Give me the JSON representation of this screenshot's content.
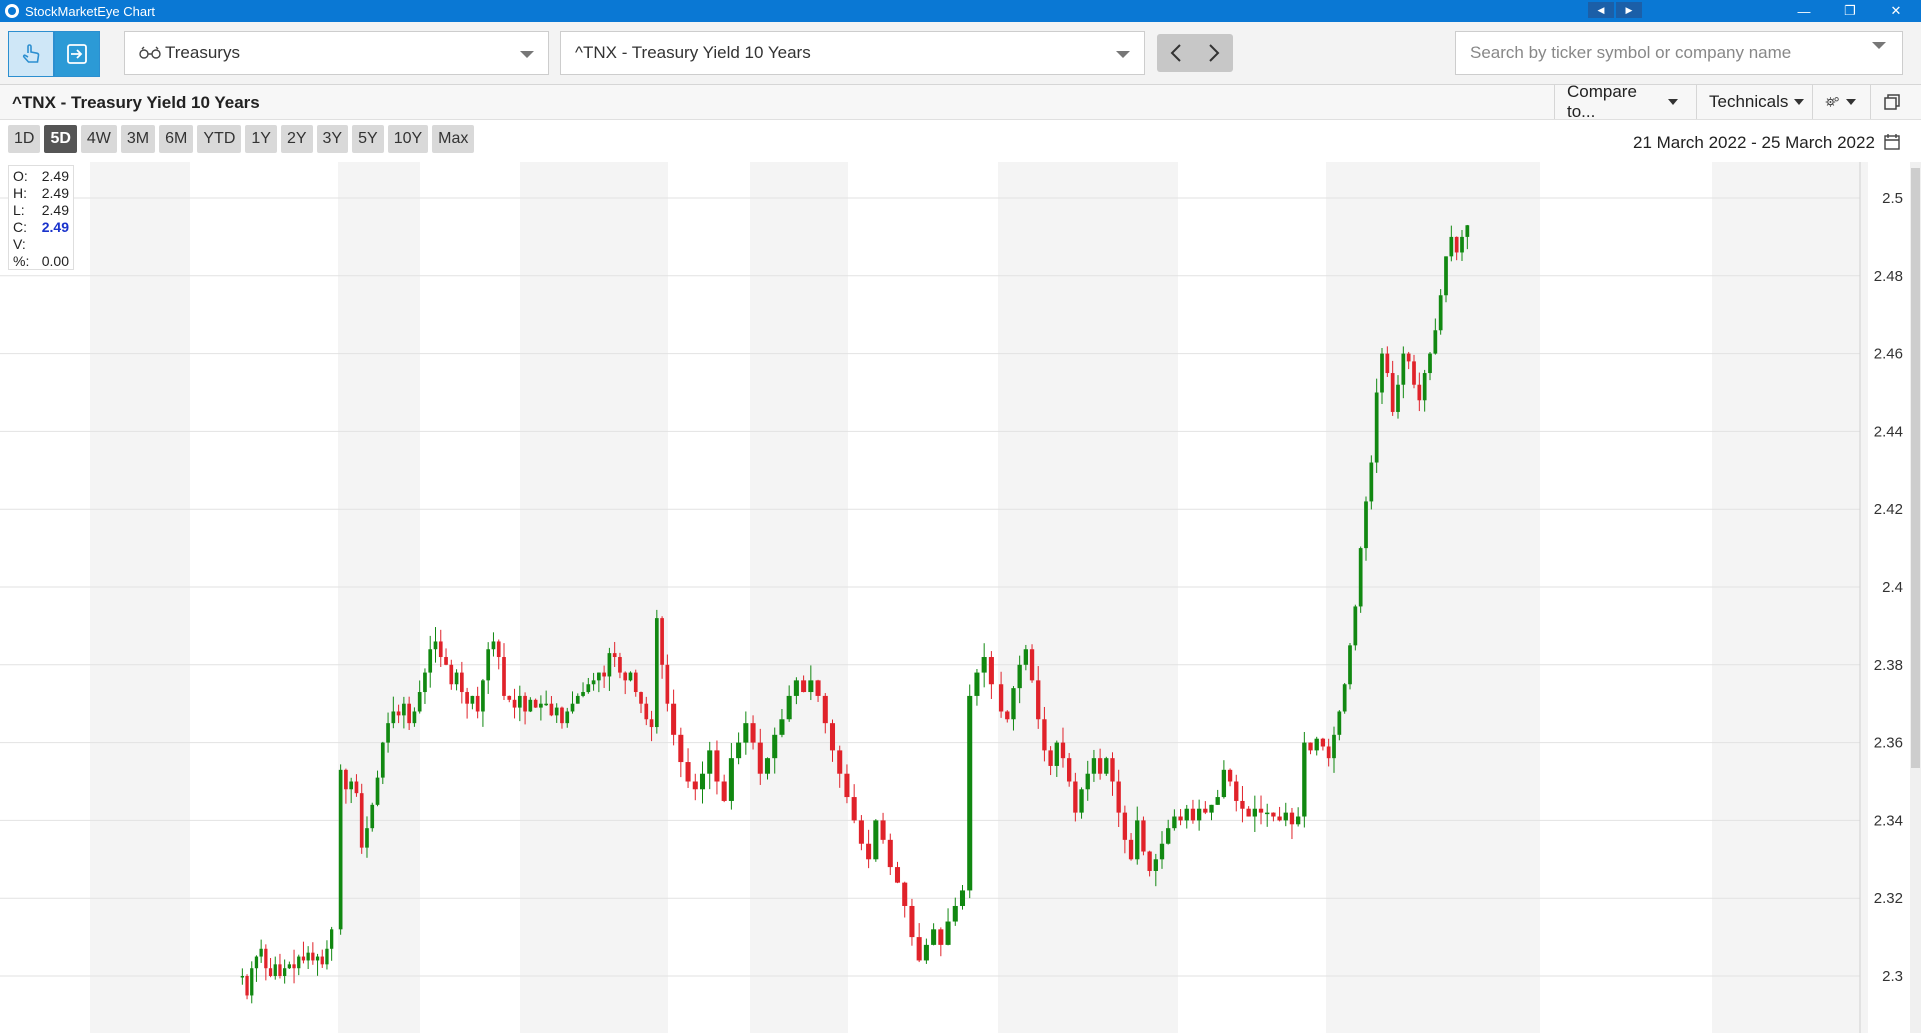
{
  "window": {
    "title": "StockMarketEye Chart"
  },
  "toolbar": {
    "list_dropdown": "Treasurys",
    "symbol_dropdown": "^TNX - Treasury Yield 10 Years",
    "search_placeholder": "Search by ticker symbol or company name"
  },
  "header": {
    "symbol_title": "^TNX - Treasury Yield 10 Years",
    "compare_label": "Compare to...",
    "technicals_label": "Technicals"
  },
  "ranges": [
    "1D",
    "5D",
    "4W",
    "3M",
    "6M",
    "YTD",
    "1Y",
    "2Y",
    "3Y",
    "5Y",
    "10Y",
    "Max"
  ],
  "active_range": "5D",
  "date_range": "21 March 2022 - 25 March 2022",
  "ohlc": {
    "o_label": "O:",
    "o": "2.49",
    "h_label": "H:",
    "h": "2.49",
    "l_label": "L:",
    "l": "2.49",
    "c_label": "C:",
    "c": "2.49",
    "v_label": "V:",
    "v": "",
    "p_label": "%:",
    "p": "0.00"
  },
  "colors": {
    "up": "#118811",
    "down": "#e0222a",
    "accent": "#0a78d4",
    "band": "#f4f4f4"
  },
  "chart_data": {
    "type": "candlestick",
    "ylim": [
      2.296,
      2.514
    ],
    "y_ticks": [
      2.3,
      2.32,
      2.34,
      2.36,
      2.38,
      2.4,
      2.42,
      2.44,
      2.46,
      2.48,
      2.5
    ],
    "y_tick_labels": [
      "2.3",
      "2.32",
      "2.34",
      "2.36",
      "2.38",
      "2.4",
      "2.42",
      "2.44",
      "2.46",
      "2.48",
      "2.5"
    ],
    "grid": true,
    "close_path": [
      2.3,
      2.295,
      2.302,
      2.305,
      2.307,
      2.302,
      2.3,
      2.303,
      2.3,
      2.302,
      2.303,
      2.302,
      2.305,
      2.304,
      2.306,
      2.304,
      2.305,
      2.303,
      2.307,
      2.312,
      2.353,
      2.348,
      2.35,
      2.347,
      2.333,
      2.338,
      2.344,
      2.351,
      2.36,
      2.365,
      2.368,
      2.367,
      2.37,
      2.365,
      2.368,
      2.373,
      2.378,
      2.384,
      2.386,
      2.382,
      2.38,
      2.375,
      2.378,
      2.373,
      2.37,
      2.372,
      2.368,
      2.376,
      2.384,
      2.386,
      2.382,
      2.372,
      2.371,
      2.369,
      2.372,
      2.368,
      2.371,
      2.369,
      2.37,
      2.37,
      2.367,
      2.369,
      2.365,
      2.368,
      2.37,
      2.372,
      2.373,
      2.375,
      2.376,
      2.378,
      2.377,
      2.383,
      2.382,
      2.378,
      2.376,
      2.378,
      2.373,
      2.37,
      2.366,
      2.364,
      2.392,
      2.38,
      2.37,
      2.362,
      2.355,
      2.35,
      2.348,
      2.352,
      2.358,
      2.35,
      2.345,
      2.356,
      2.36,
      2.365,
      2.36,
      2.352,
      2.356,
      2.362,
      2.366,
      2.372,
      2.376,
      2.373,
      2.376,
      2.372,
      2.365,
      2.358,
      2.352,
      2.346,
      2.34,
      2.334,
      2.33,
      2.34,
      2.335,
      2.328,
      2.324,
      2.318,
      2.31,
      2.304,
      2.308,
      2.312,
      2.308,
      2.314,
      2.318,
      2.322,
      2.372,
      2.378,
      2.382,
      2.375,
      2.368,
      2.366,
      2.374,
      2.38,
      2.384,
      2.376,
      2.366,
      2.358,
      2.354,
      2.36,
      2.356,
      2.35,
      2.342,
      2.348,
      2.352,
      2.356,
      2.352,
      2.356,
      2.35,
      2.342,
      2.335,
      2.33,
      2.34,
      2.332,
      2.327,
      2.33,
      2.334,
      2.338,
      2.341,
      2.34,
      2.343,
      2.34,
      2.343,
      2.342,
      2.344,
      2.346,
      2.353,
      2.35,
      2.345,
      2.343,
      2.341,
      2.343,
      2.342,
      2.342,
      2.341,
      2.34,
      2.342,
      2.339,
      2.341,
      2.36,
      2.358,
      2.361,
      2.359,
      2.356,
      2.362,
      2.368,
      2.375,
      2.385,
      2.395,
      2.41,
      2.422,
      2.432,
      2.45,
      2.46,
      2.455,
      2.445,
      2.452,
      2.46,
      2.458,
      2.452,
      2.448,
      2.455,
      2.46,
      2.466,
      2.475,
      2.485,
      2.49,
      2.486,
      2.49,
      2.493
    ]
  }
}
